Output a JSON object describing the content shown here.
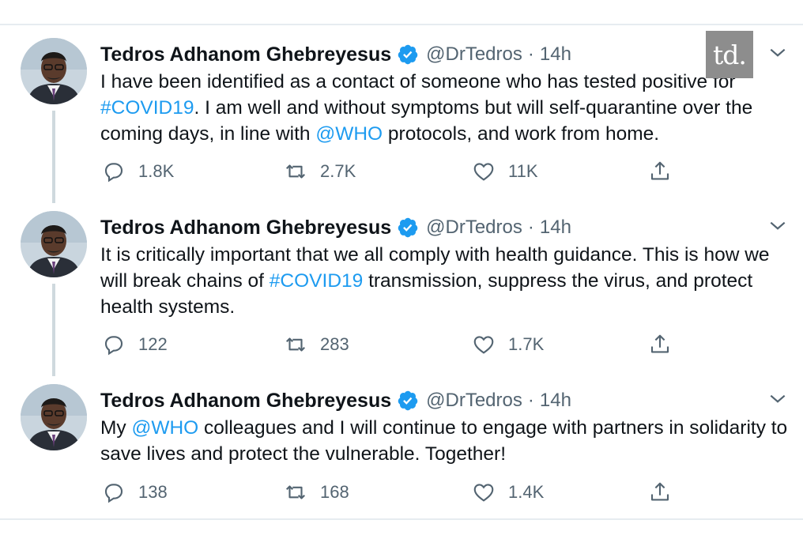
{
  "watermark": {
    "text": "td.",
    "color": "#8d8d8d"
  },
  "colors": {
    "link": "#1d9bf0",
    "muted": "#536471",
    "text": "#0f1419",
    "verified": "#1d9bf0"
  },
  "icons": {
    "reply": "reply-icon",
    "retweet": "retweet-icon",
    "like": "heart-icon",
    "share": "share-icon",
    "verified": "verified-badge-icon",
    "more": "chevron-down-icon"
  },
  "tweets": [
    {
      "author": {
        "name": "Tedros Adhanom Ghebreyesus",
        "handle": "@DrTedros"
      },
      "separator": "·",
      "time": "14h",
      "text": [
        {
          "t": "I have been identified as a contact of someone who has tested positive for "
        },
        {
          "t": "#COVID19",
          "link": true
        },
        {
          "t": ". I am well and without symptoms but will self-quarantine over the coming days, in line with "
        },
        {
          "t": "@WHO",
          "link": true
        },
        {
          "t": " protocols, and work from home."
        }
      ],
      "stats": {
        "replies": "1.8K",
        "retweets": "2.7K",
        "likes": "11K"
      }
    },
    {
      "author": {
        "name": "Tedros Adhanom Ghebreyesus",
        "handle": "@DrTedros"
      },
      "separator": "·",
      "time": "14h",
      "text": [
        {
          "t": "It is critically important that we all comply with health guidance. This is how we will break chains of "
        },
        {
          "t": "#COVID19",
          "link": true
        },
        {
          "t": " transmission, suppress the virus, and protect health systems."
        }
      ],
      "stats": {
        "replies": "122",
        "retweets": "283",
        "likes": "1.7K"
      }
    },
    {
      "author": {
        "name": "Tedros Adhanom Ghebreyesus",
        "handle": "@DrTedros"
      },
      "separator": "·",
      "time": "14h",
      "text": [
        {
          "t": "My "
        },
        {
          "t": "@WHO",
          "link": true
        },
        {
          "t": " colleagues and I will continue to engage with partners in solidarity to save lives and protect the vulnerable. Together!"
        }
      ],
      "stats": {
        "replies": "138",
        "retweets": "168",
        "likes": "1.4K"
      }
    }
  ]
}
